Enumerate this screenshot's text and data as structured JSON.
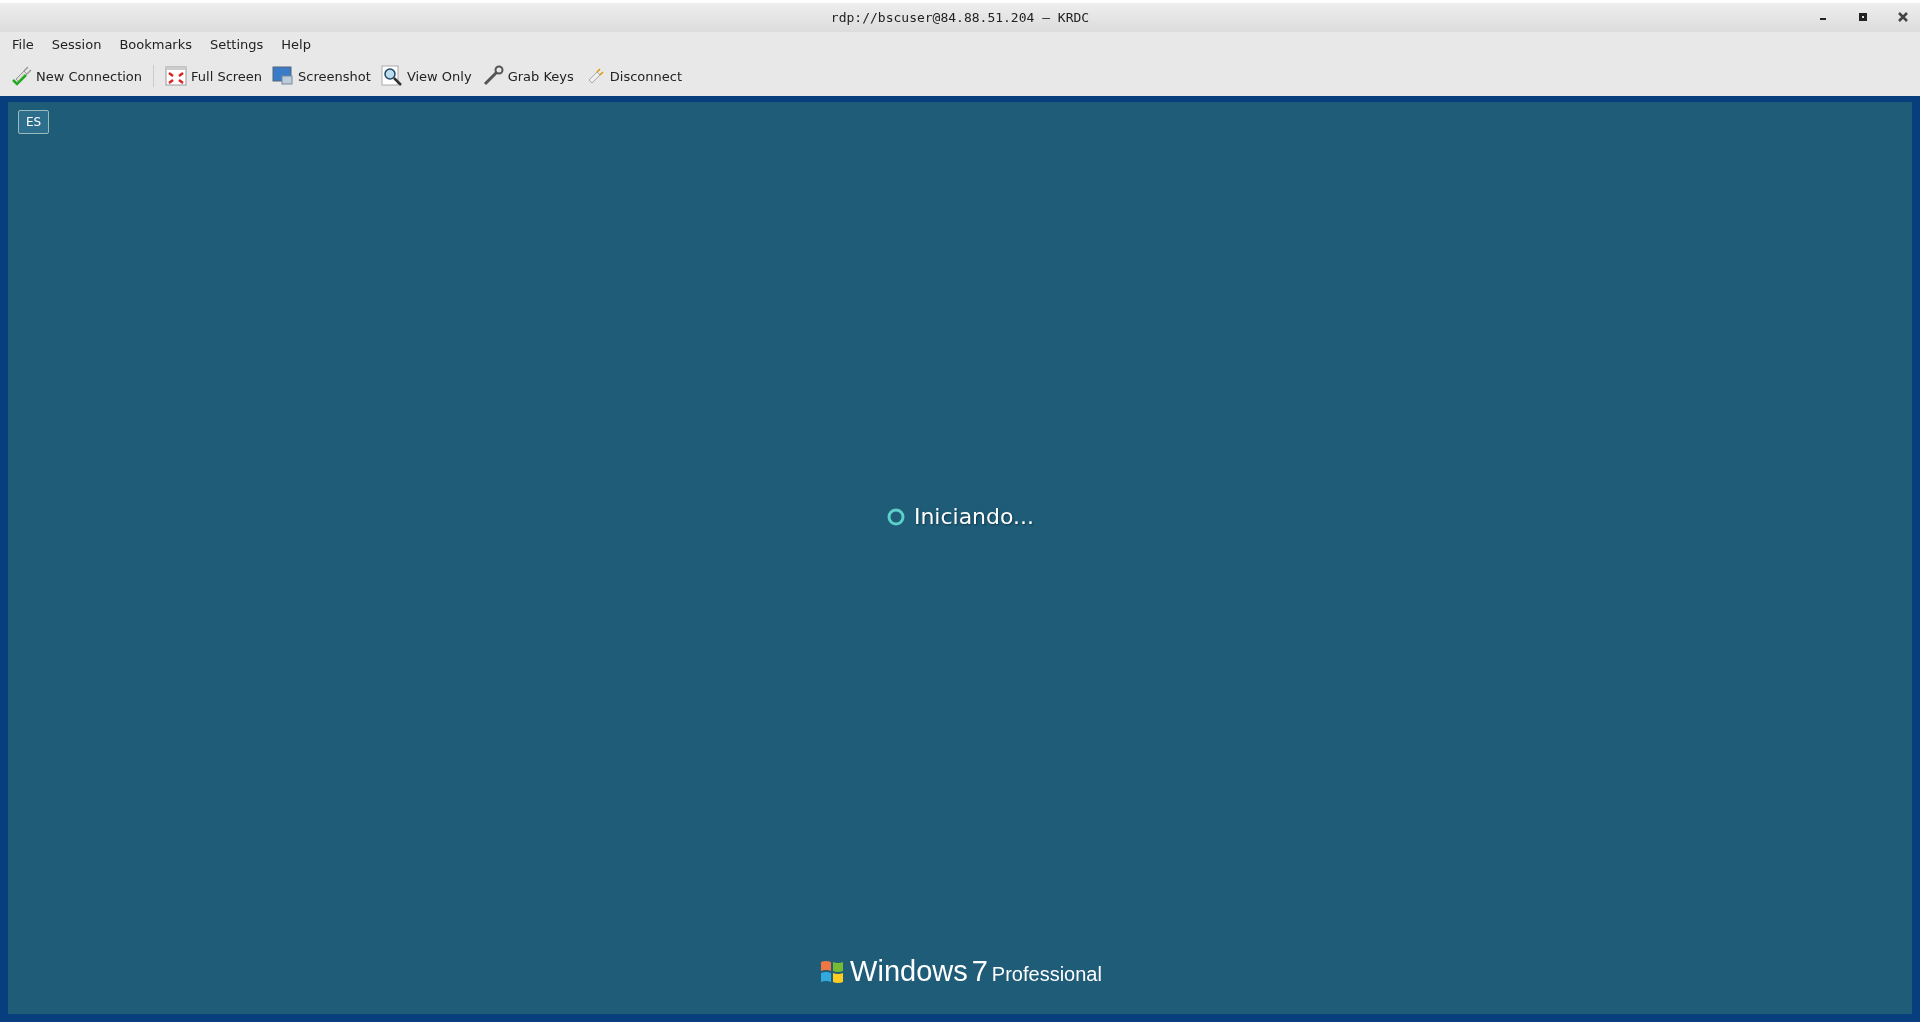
{
  "window": {
    "title": "rdp://bscuser@84.88.51.204 – KRDC"
  },
  "menu": [
    "File",
    "Session",
    "Bookmarks",
    "Settings",
    "Help"
  ],
  "toolbar": [
    {
      "kind": "connect",
      "label": "New Connection"
    },
    {
      "kind": "fullscreen",
      "label": "Full Screen"
    },
    {
      "kind": "screenshot",
      "label": "Screenshot"
    },
    {
      "kind": "viewonly",
      "label": "View Only"
    },
    {
      "kind": "grabkeys",
      "label": "Grab Keys"
    },
    {
      "kind": "disconnect",
      "label": "Disconnect"
    }
  ],
  "remote": {
    "language_badge": "ES",
    "status": "Iniciando...",
    "brand": "Windows",
    "version": "7",
    "edition": "Professional"
  }
}
